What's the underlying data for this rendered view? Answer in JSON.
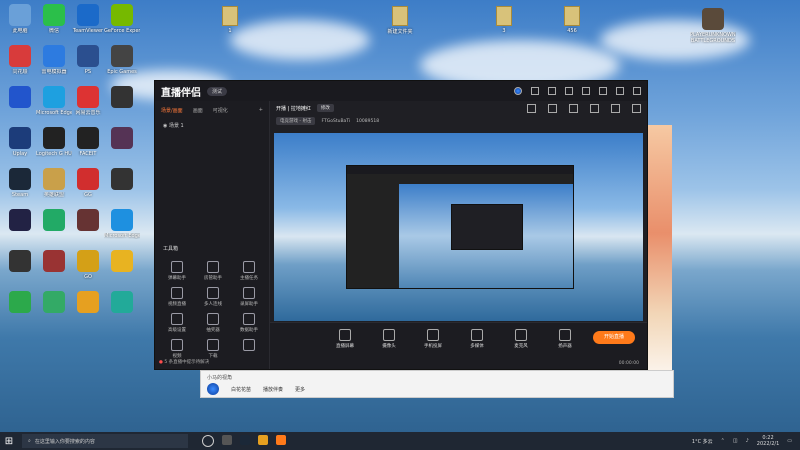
{
  "desktop": {
    "icons": [
      {
        "label": "此电脑",
        "color": "#6aa0d8"
      },
      {
        "label": "微信",
        "color": "#2bbf4a"
      },
      {
        "label": "TeamViewer",
        "color": "#1b6ac9"
      },
      {
        "label": "GeForce Experience",
        "color": "#76b900"
      },
      {
        "label": "同花顺",
        "color": "#d83b3b"
      },
      {
        "label": "雷电模拟器",
        "color": "#2d7be0"
      },
      {
        "label": "PS",
        "color": "#2b4f8f"
      },
      {
        "label": "Epic Games",
        "color": "#444"
      },
      {
        "label": "",
        "color": "#2255cc"
      },
      {
        "label": "Microsoft Edge",
        "color": "#1ea0e0"
      },
      {
        "label": "网易云音乐",
        "color": "#d33"
      },
      {
        "label": "",
        "color": "#333"
      },
      {
        "label": "Uplay",
        "color": "#1c3c7a"
      },
      {
        "label": "Logitech G HUB",
        "color": "#222"
      },
      {
        "label": "FACEIT",
        "color": "#222"
      },
      {
        "label": "",
        "color": "#553355"
      },
      {
        "label": "Steam",
        "color": "#1b2838"
      },
      {
        "label": "英雄联盟",
        "color": "#c9a04a"
      },
      {
        "label": "GG",
        "color": "#d12e2e"
      },
      {
        "label": "",
        "color": "#333"
      },
      {
        "label": "",
        "color": "#224"
      },
      {
        "label": "",
        "color": "#2a6"
      },
      {
        "label": "",
        "color": "#633"
      },
      {
        "label": "Microsoft Edge",
        "color": "#1e90e0"
      },
      {
        "label": "",
        "color": "#333"
      },
      {
        "label": "",
        "color": "#933"
      },
      {
        "label": "GO",
        "color": "#d4a017"
      },
      {
        "label": "",
        "color": "#e8b321"
      },
      {
        "label": "",
        "color": "#2ca94b"
      },
      {
        "label": "",
        "color": "#3a6"
      },
      {
        "label": "",
        "color": "#e6a020"
      },
      {
        "label": "",
        "color": "#2a9"
      }
    ],
    "folders": [
      {
        "label": "1"
      },
      {
        "label": "新建文件夹"
      },
      {
        "label": "3"
      },
      {
        "label": "456"
      }
    ],
    "right_icons": [
      {
        "label": "PLAYERUNKNOWN'S BATTLEGROUNDS"
      }
    ]
  },
  "app": {
    "title": "直播伴侣",
    "badge": "测试",
    "left_tabs": [
      "场景/画面",
      "画面",
      "可视化"
    ],
    "scene_label": "场景 1",
    "tools_title": "工具箱",
    "tools": [
      "弹幕助手",
      "房管助手",
      "主播任务",
      "视频直播",
      "多人连线",
      "录屏助手",
      "高级设置",
      "抽奖器",
      "数据助手",
      "视频",
      "下载",
      ""
    ],
    "notice": "5 条直播中提示待解决",
    "top": {
      "start_label": "开播 | 拉地摊红",
      "btn_label": "修改",
      "category": "电竞游戏 - 射击",
      "channel": "FTGoStuBaTi",
      "room_id": "10089518"
    },
    "bottom_tools": [
      "直播屏幕",
      "摄像头",
      "手机投屏",
      "多媒体",
      "麦克风",
      "扬声器"
    ],
    "live_button": "开始直播",
    "stats": "00:00:00"
  },
  "chat": {
    "row1": "小马的视角",
    "row2": [
      "白花花苗",
      "播放伴奏",
      "更多"
    ]
  },
  "taskbar": {
    "search_placeholder": "在这里输入你要搜索的内容",
    "weather": "1°C 多云",
    "time": "0:22",
    "date": "2022/2/1"
  }
}
